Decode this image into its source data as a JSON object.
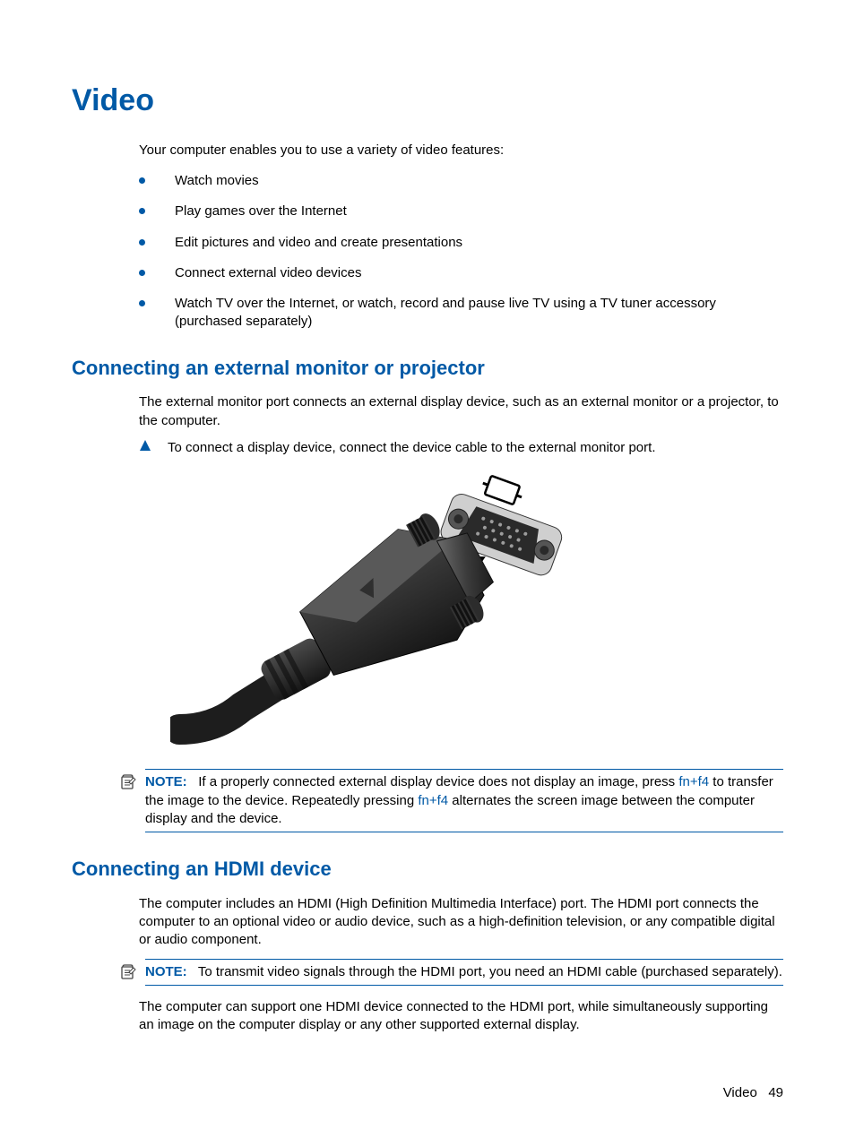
{
  "h1": "Video",
  "intro": "Your computer enables you to use a variety of video features:",
  "bullets": [
    "Watch movies",
    "Play games over the Internet",
    "Edit pictures and video and create presentations",
    "Connect external video devices",
    "Watch TV over the Internet, or watch, record and pause live TV using a TV tuner accessory (purchased separately)"
  ],
  "section1": {
    "title": "Connecting an external monitor or projector",
    "para": "The external monitor port connects an external display device, such as an external monitor or a projector, to the computer.",
    "step": "To connect a display device, connect the device cable to the external monitor port.",
    "note_label": "NOTE:",
    "note_pre": "If a properly connected external display device does not display an image, press ",
    "note_kbd1": "fn+f4",
    "note_mid": " to transfer the image to the device. Repeatedly pressing ",
    "note_kbd2": "fn+f4",
    "note_post": " alternates the screen image between the computer display and the device."
  },
  "section2": {
    "title": "Connecting an HDMI device",
    "para1": "The computer includes an HDMI (High Definition Multimedia Interface) port. The HDMI port connects the computer to an optional video or audio device, such as a high-definition television, or any compatible digital or audio component.",
    "note_label": "NOTE:",
    "note_text": "To transmit video signals through the HDMI port, you need an HDMI cable (purchased separately).",
    "para2": "The computer can support one HDMI device connected to the HDMI port, while simultaneously supporting an image on the computer display or any other supported external display."
  },
  "footer": {
    "section": "Video",
    "page": "49"
  }
}
